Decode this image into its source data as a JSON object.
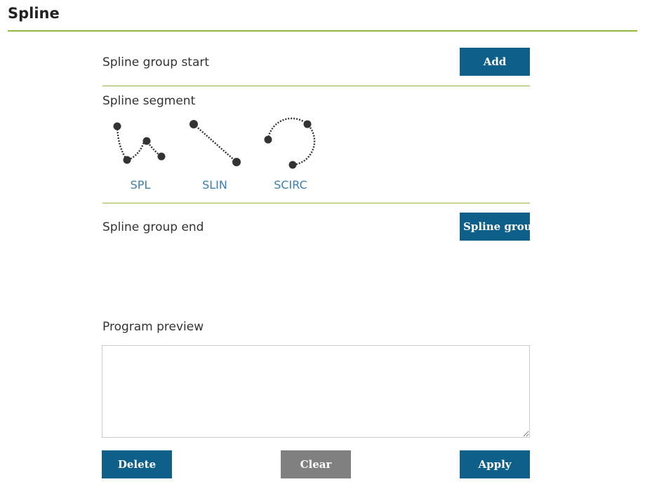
{
  "page": {
    "title": "Spline"
  },
  "group_start": {
    "label": "Spline group start",
    "button_label": "Add"
  },
  "segment": {
    "label": "Spline segment",
    "items": [
      {
        "label": "SPL",
        "icon": "spl-curve-icon"
      },
      {
        "label": "SLIN",
        "icon": "slin-line-icon"
      },
      {
        "label": "SCIRC",
        "icon": "scirc-arc-icon"
      }
    ]
  },
  "group_end": {
    "label": "Spline group end",
    "button_label": "Spline group end"
  },
  "preview": {
    "label": "Program preview",
    "value": ""
  },
  "footer": {
    "delete_label": "Delete",
    "clear_label": "Clear",
    "apply_label": "Apply"
  },
  "colors": {
    "accent_green": "#8fb83c",
    "button_blue": "#0e5f8a",
    "button_gray": "#808080",
    "link_blue": "#3a7fb0"
  }
}
